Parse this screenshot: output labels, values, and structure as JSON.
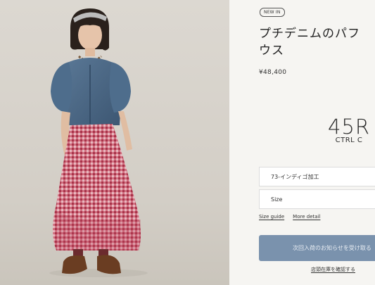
{
  "product": {
    "badge": "NEW IN",
    "title_line1": "プチデニムのパフ",
    "title_line2": "ウス",
    "price": "¥48,400"
  },
  "brand": {
    "logo_main": "45R",
    "logo_sub": "CTRL C"
  },
  "options": {
    "color_value": "73-インディゴ加工",
    "size_label": "Size"
  },
  "links": {
    "size_guide": "Size guide",
    "more_detail": "More detail"
  },
  "actions": {
    "notify_label": "次回入荷のお知らせを受け取る",
    "store_stock_label": "店頭在庫を確認する"
  },
  "colors": {
    "notify_button": "#7a92ad",
    "shirt_denim": "#4a6583",
    "skirt_gingham": "#c24a5e",
    "background": "#f6f5f2"
  }
}
